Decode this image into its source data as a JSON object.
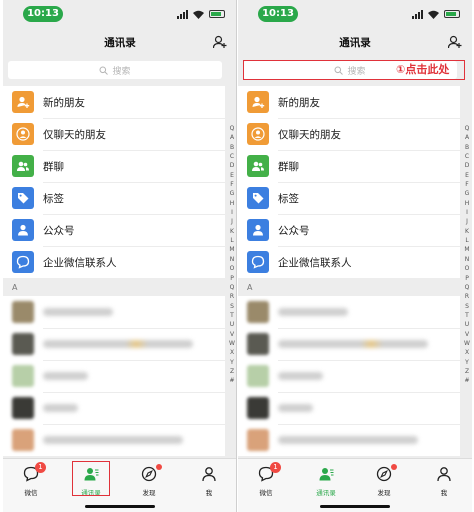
{
  "status": {
    "time": "10:13"
  },
  "header": {
    "title": "通讯录"
  },
  "search": {
    "placeholder": "搜索"
  },
  "annotation": {
    "text": "①点击此处"
  },
  "menu": [
    {
      "label": "新的朋友",
      "icon": "add-friend-icon",
      "color": "#f09b36"
    },
    {
      "label": "仅聊天的朋友",
      "icon": "person-icon",
      "color": "#f09b36"
    },
    {
      "label": "群聊",
      "icon": "group-icon",
      "color": "#43b048"
    },
    {
      "label": "标签",
      "icon": "tag-icon",
      "color": "#3c7fe0"
    },
    {
      "label": "公众号",
      "icon": "person-icon",
      "color": "#3c7fe0"
    },
    {
      "label": "企业微信联系人",
      "icon": "chat-bubble-icon",
      "color": "#3c7fe0"
    }
  ],
  "section": {
    "letter": "A"
  },
  "index_letters": [
    "Q",
    "A",
    "B",
    "C",
    "D",
    "E",
    "F",
    "G",
    "H",
    "I",
    "J",
    "K",
    "L",
    "M",
    "N",
    "O",
    "P",
    "Q",
    "R",
    "S",
    "T",
    "U",
    "V",
    "W",
    "X",
    "Y",
    "Z",
    "#"
  ],
  "tabs": [
    {
      "label": "微信",
      "badge": "1"
    },
    {
      "label": "通讯录"
    },
    {
      "label": "发现"
    },
    {
      "label": "我"
    }
  ],
  "colors": {
    "accent": "#2aa84a",
    "highlight": "#e0323a",
    "badge": "#f04a43"
  }
}
